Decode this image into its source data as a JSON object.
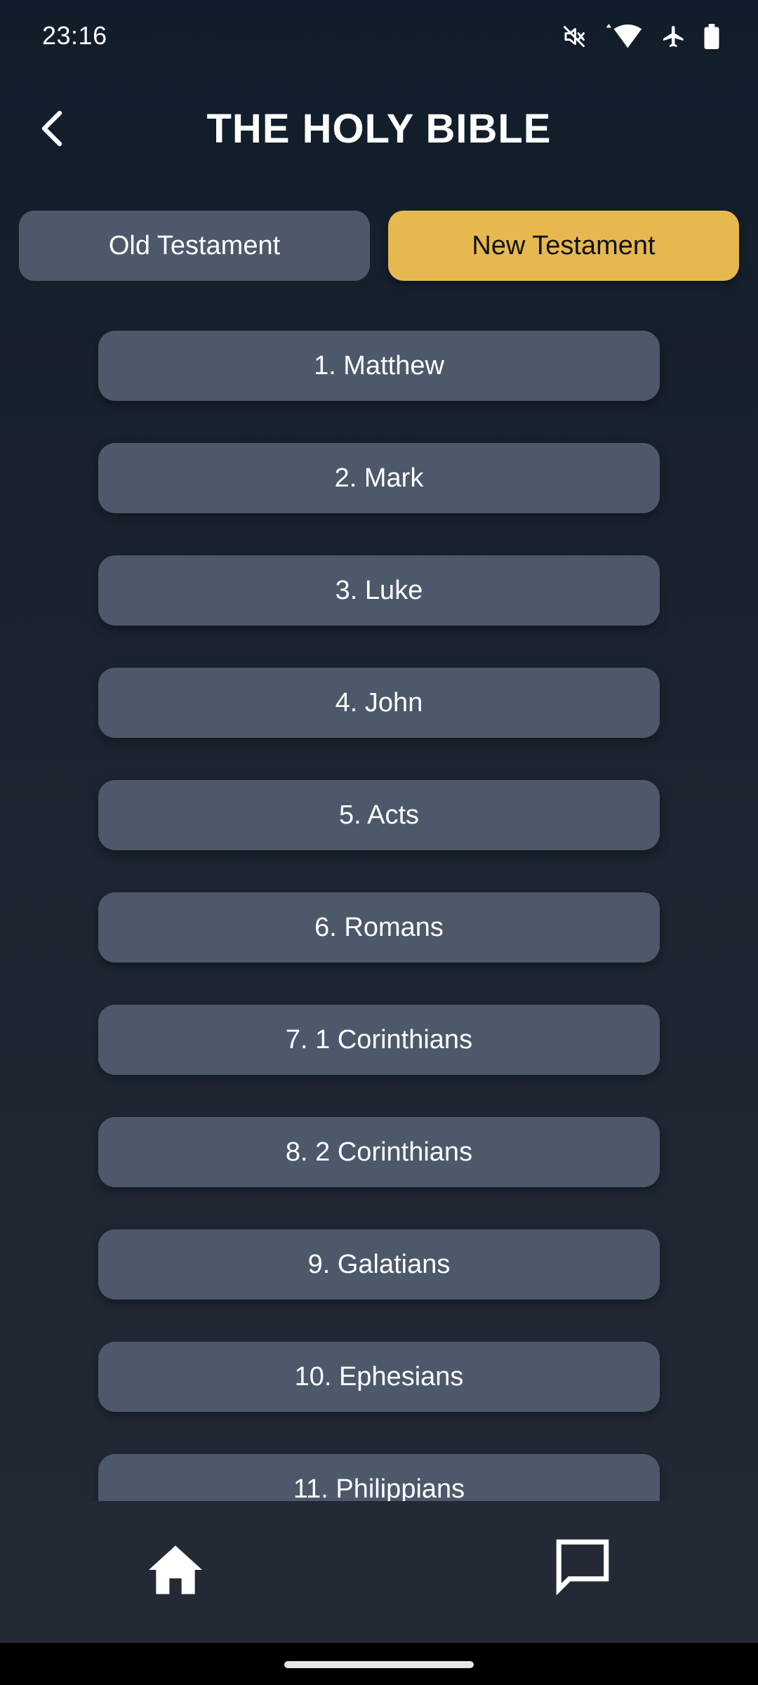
{
  "status_bar": {
    "time": "23:16",
    "icons": [
      "mute-icon",
      "wifi-icon",
      "airplane-icon",
      "battery-icon"
    ]
  },
  "header": {
    "title": "THE HOLY BIBLE",
    "back_icon": "chevron-left-icon"
  },
  "tabs": [
    {
      "label": "Old Testament",
      "active": false
    },
    {
      "label": "New Testament",
      "active": true
    }
  ],
  "books": [
    "1. Matthew",
    "2. Mark",
    "3. Luke",
    "4. John",
    "5. Acts",
    "6. Romans",
    "7. 1 Corinthians",
    "8. 2 Corinthians",
    "9. Galatians",
    "10. Ephesians",
    "11. Philippians"
  ],
  "bottom_nav": {
    "items": [
      "home-icon",
      "chat-icon"
    ]
  },
  "colors": {
    "accent": "#e6b84f",
    "button": "#4d586b",
    "background_top": "#111d2a",
    "background_bottom": "#232a35"
  }
}
